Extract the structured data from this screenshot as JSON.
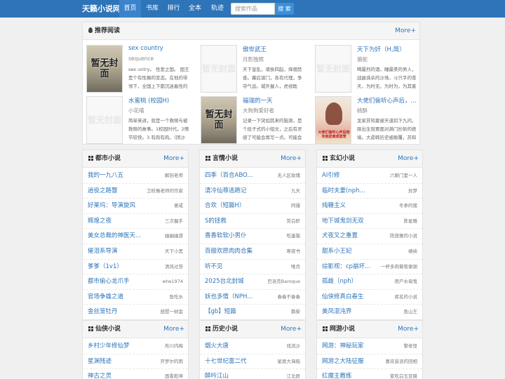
{
  "nav": {
    "brand": "天籁小说网",
    "items": [
      "首页",
      "书库",
      "排行",
      "全本",
      "轨迹"
    ],
    "search_placeholder": "搜索作品",
    "search_button": "搜 索"
  },
  "featured": {
    "title": "推荐阅读",
    "more": "More+",
    "no_cover": "暂无封面",
    "books": [
      {
        "title": "sex country",
        "author": "sequence",
        "desc": "sex untry。 性爱之国。 国王是个有性瘾的变态。在他的带领下，全国上下都沉迷着性的",
        "cover": "image"
      },
      {
        "title": "傲世武王",
        "author": "月影独照",
        "desc": "天下皇乱，诸侯四起，烽烟焚香。幕后谋门，各有代理，争夺气运。城外握人，虎视耽",
        "cover": "none"
      },
      {
        "title": "天下为奸（H,简）",
        "author": "骆驼",
        "desc": "喝最烈的酒，睡最美的男人，战曲诛杀的沙场，斗只手的苍天，为时无，为时为，为其客",
        "cover": "none"
      },
      {
        "title": "水蜜桃 (校园H)",
        "author": "小花喵",
        "desc": "简单来讲，就是一个救赎与被救赎的故事。1校园时代。2情节较快。3.有肉有肉。（阴沙",
        "cover": "none"
      },
      {
        "title": "福瑞的一天",
        "author": "大狗狗爱好者",
        "desc": "记录一下突如其来的脑洞，是个段子式的小短文，之后有灵感了可能会再写一点。可能会",
        "cover": "image"
      },
      {
        "title": "大佬们偷听心声后，...",
        "author": "桃酥",
        "desc": "龙家苏知夏被天道扣下九问，刚出生就要面对满门抄斩的绝境。大虐韩历史被颠覆，苏知",
        "cover": "image2",
        "cover_text": "大佬们偷听心声后炮灰她逆袭成团宠"
      }
    ]
  },
  "categories": [
    {
      "title": "都市小说",
      "more": "More+",
      "items": [
        {
          "title": "我的一九八五",
          "author": "解剖老师"
        },
        {
          "title": "逍役之路簪",
          "author": "卫校做老师的作家"
        },
        {
          "title": "好莱坞：导演旋风",
          "author": "意戒"
        },
        {
          "title": "辉煌之夜",
          "author": "三次握手"
        },
        {
          "title": "美女总裁的神医天...",
          "author": "幽幽幽游"
        },
        {
          "title": "催泪系导演",
          "author": "天下小黑"
        },
        {
          "title": "爹爹（1v1）",
          "author": "清风过苔"
        },
        {
          "title": "都市偷心龙爪手",
          "author": "wtw1974"
        },
        {
          "title": "官场争雄之道",
          "author": "鱼吃水"
        },
        {
          "title": "金丝笼牡丹",
          "author": "琵琶一树金"
        }
      ]
    },
    {
      "title": "言情小说",
      "more": "More+",
      "items": [
        {
          "title": "四季（百合ABO...",
          "author": "无人区玫瑰"
        },
        {
          "title": "清冷仙尊逃跑记",
          "author": "九天"
        },
        {
          "title": "合欢（短篇H）",
          "author": "阿僵"
        },
        {
          "title": "S的拯救",
          "author": "劳白肝"
        },
        {
          "title": "香香软软小男仆",
          "author": "吃蛋猫"
        },
        {
          "title": "百般欢愿肉肉合集",
          "author": "寒夜书"
        },
        {
          "title": "听不见",
          "author": "唯月"
        },
        {
          "title": "2025台北封城",
          "author": "巴洛克Baroque"
        },
        {
          "title": "妖也多情（NPH...",
          "author": "春春不春春"
        },
        {
          "title": "【gb】短篇",
          "author": "鹅柴"
        }
      ]
    },
    {
      "title": "玄幻小说",
      "more": "More+",
      "items": [
        {
          "title": "AI引修",
          "author": "六眼门里一人"
        },
        {
          "title": "临时夫妻(nph...",
          "author": "异梦"
        },
        {
          "title": "纯糖主义",
          "author": "冬季的猪"
        },
        {
          "title": "地下城鬼剑无双",
          "author": "陈星雅"
        },
        {
          "title": "犬夜叉之重置",
          "author": "陈放雅的小说"
        },
        {
          "title": "甜系小王妃",
          "author": "裙袂"
        },
        {
          "title": "综影视：cp崩坏...",
          "author": "一杯多肉葡萄谢谢"
        },
        {
          "title": "孤雌（nph）",
          "author": "用户水母鬼"
        },
        {
          "title": "仙侠修真白春生",
          "author": "疾名的小说"
        },
        {
          "title": "美凤混沌界",
          "author": "鱼山王"
        }
      ]
    },
    {
      "title": "仙侠小说",
      "more": "More+",
      "items": [
        {
          "title": "乡村少年修仙梦",
          "author": "布川内梅"
        },
        {
          "title": "星渊残迹",
          "author": "开罗尔的雨"
        },
        {
          "title": "神古之灵",
          "author": "面看乾坤"
        }
      ]
    },
    {
      "title": "历史小说",
      "more": "More+",
      "items": [
        {
          "title": "烟火大唐",
          "author": "戏流沙"
        },
        {
          "title": "十七世纪富二代",
          "author": "星辰大海船"
        },
        {
          "title": "醉吟江山",
          "author": "江北辰"
        }
      ]
    },
    {
      "title": "网游小说",
      "more": "More+",
      "items": [
        {
          "title": "网游：神秘玩家",
          "author": "黎老怪"
        },
        {
          "title": "网游之大陆征服",
          "author": "喜欢音浪的回相"
        },
        {
          "title": "红魔主教练",
          "author": "紫吃白玉豆腐"
        }
      ]
    }
  ]
}
